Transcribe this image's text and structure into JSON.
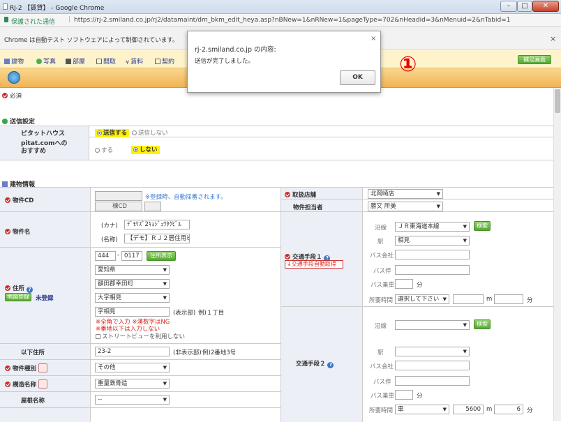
{
  "window": {
    "title": "RJ-2 【賃貸】 - Google Chrome"
  },
  "url": {
    "secure_label": "保護された通信",
    "address": "https://rj-2.smiland.co.jp/rj2/datamaint/dm_bkm_edit_heya.asp?nBNew=1&nRNew=1&pageType=702&nHeadid=3&nMenuid=2&nTabid=1"
  },
  "infobar": {
    "message": "Chrome は自動テスト ソフトウェアによって制御されています。",
    "close": "×"
  },
  "nav": {
    "items": [
      "建物",
      "写真",
      "部屋",
      "間取",
      "賃料",
      "契約"
    ],
    "right_button": "補足画面"
  },
  "dialog": {
    "title": "rj-2.smiland.co.jp の内容:",
    "message": "送信が完了しました。",
    "ok": "OK",
    "close": "×"
  },
  "annotation": "①",
  "required_label": "必須",
  "send_settings": {
    "title": "送信設定",
    "rows": [
      {
        "label": "ピタットハウス",
        "on": "送信する",
        "off": "送信しない"
      },
      {
        "label": "pitat.comへの\nおすすめ",
        "on": "する",
        "off": "しない"
      }
    ]
  },
  "building": {
    "title": "建物情報",
    "bukken_cd": {
      "label": "物件CD",
      "note": "※登録時、自動採番されます。",
      "sub_label": "棟CD"
    },
    "bukken_name": {
      "label": "物件名",
      "kana_label": "(カナ)",
      "kana_value": "ﾃﾞﾓﾘｽﾞ2ｷｮｼﾞｭｳﾀｸﾋﾞﾙ",
      "name_label": "(名称)",
      "name_value": "【デモ】ＲＪ２居住用ビル"
    },
    "address": {
      "label": "住所",
      "map_button": "地図登録",
      "map_status": "未登録",
      "zip1": "444",
      "zip2": "0117",
      "zip_button": "住所表示",
      "pref": "愛知県",
      "city": "額田郡幸田町",
      "area": "大字相見",
      "aza": "字相見",
      "display_note": "(表示部)",
      "example": "例)１丁目",
      "warn1": "※全角で入力 ※漢数字はNG",
      "warn2": "※番地以下は入力しない",
      "streetview": "ストリートビューを利用しない"
    },
    "below_address": {
      "label": "以下住所",
      "value": "23-2",
      "note": "(非表示部)",
      "example": "例)2番地3号"
    },
    "bukken_type": {
      "label": "物件種別",
      "value": "その他"
    },
    "structure": {
      "label": "構造名称",
      "value": "重量鉄骨造"
    },
    "roof": {
      "label": "屋根名称",
      "value": "--"
    }
  },
  "right": {
    "store": {
      "label": "取扱店舗",
      "value": "北岡崎店"
    },
    "staff": {
      "label": "物件担当者",
      "value": "勝又 所美"
    },
    "transport1": {
      "label": "交通手段１",
      "auto_button": "交通手段自動取得",
      "line_label": "沿線",
      "line_value": "ＪＲ東海道本線",
      "search": "検索",
      "station_label": "駅",
      "station_value": "相見",
      "bus_company": "バス会社",
      "bus_stop": "バス停",
      "bus_ride": "バス乗車",
      "minutes": "分",
      "time_label": "所要時間",
      "time_select": "選択して下さい",
      "m": "m"
    },
    "transport2": {
      "label": "交通手段２",
      "line_label": "沿線",
      "search": "検索",
      "station_label": "駅",
      "bus_company": "バス会社",
      "bus_stop": "バス停",
      "bus_ride": "バス乗車",
      "minutes": "分",
      "time_label": "所要時間",
      "time_select": "車",
      "distance": "5600",
      "m": "m",
      "time": "6",
      "min2": "分"
    }
  }
}
